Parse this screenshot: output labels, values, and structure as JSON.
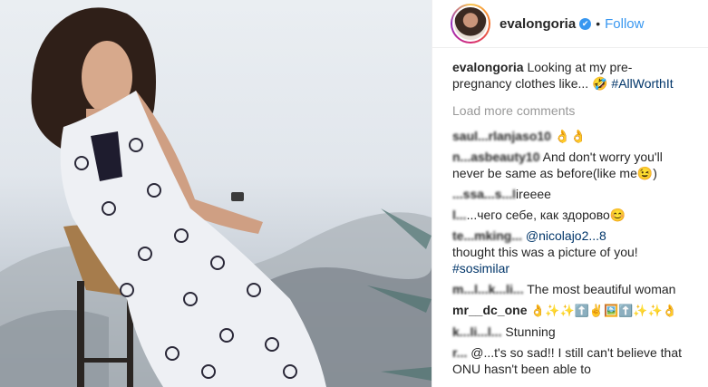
{
  "post": {
    "username": "evalongoria",
    "follow_label": "Follow",
    "dot": "•",
    "verified_mark": "✔"
  },
  "caption": {
    "user": "evalongoria",
    "text": " Looking at my pre-pregnancy clothes like... 🤣 ",
    "hashtag": "#AllWorthIt"
  },
  "load_more": "Load more comments",
  "comments": [
    {
      "user": "saul...rlanjaso10",
      "text": " 👌👌"
    },
    {
      "user": "n...asbeauty10",
      "text": " And don't worry you'll never be same as before(like me😉)"
    },
    {
      "user": "...ssa...s...l",
      "text": "ireeee"
    },
    {
      "user": "l...",
      "text": "...чего себе, как здорово😊"
    },
    {
      "user": "te...mking...",
      "text": " @nicolajo2...8",
      "text2": "thought this was a picture of you!",
      "hashtag": "#sosimilar"
    },
    {
      "user": "m...l...k...li...",
      "text": " The most beautiful woman"
    },
    {
      "user": "mr__dc_one",
      "text": " 👌✨✨⬆️✌️🖼️⬆️✨✨👌"
    },
    {
      "user": "k...li...l...",
      "text": " Stunning"
    },
    {
      "user": "r...",
      "text": " @...t's so sad!! I still can't believe that ONU hasn't been able to"
    }
  ]
}
